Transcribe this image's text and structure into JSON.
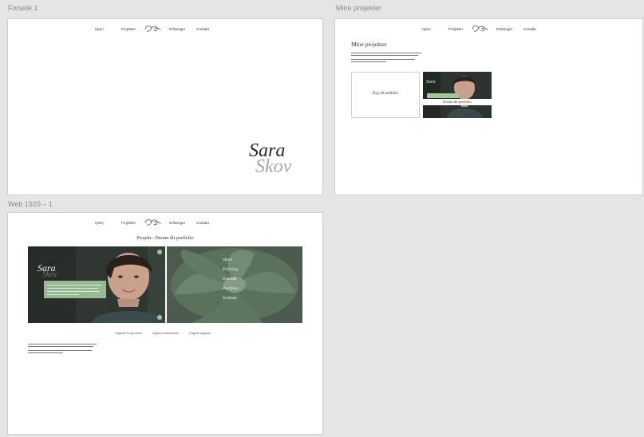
{
  "artboards": {
    "forside": {
      "label": "Forside.1"
    },
    "mine": {
      "label": "Mine projekter"
    },
    "web": {
      "label": "Web 1920 – 1"
    }
  },
  "nav": {
    "items": [
      "Hjem",
      "Projekter",
      "Erfaringer",
      "Kontakt"
    ]
  },
  "forside": {
    "logo_line1": "Sara",
    "logo_line2": "Skov"
  },
  "mine": {
    "heading": "Mine projekter",
    "card1_label": "Byg dit portfolio",
    "card2_label": "Dream dit portfolio",
    "card2_logo": "Sara"
  },
  "web": {
    "title": "Projekt - Dream dit portfolio",
    "mockup_logo_line1": "Sara",
    "mockup_logo_line2": "Skov",
    "menu": [
      "Hjem",
      "Erfaring",
      "Kontakt",
      "Portfolio",
      "Kontakt"
    ],
    "strip": [
      "Original HD gennemt",
      "Opgave kodestruktur",
      "Original dagsport"
    ]
  },
  "colors": {
    "canvas": "#e5e5e5",
    "artboard": "#ffffff",
    "accent_green": "#9fc79a",
    "dark_photo": "#2f3630",
    "succulent": "#6f8a6e"
  }
}
